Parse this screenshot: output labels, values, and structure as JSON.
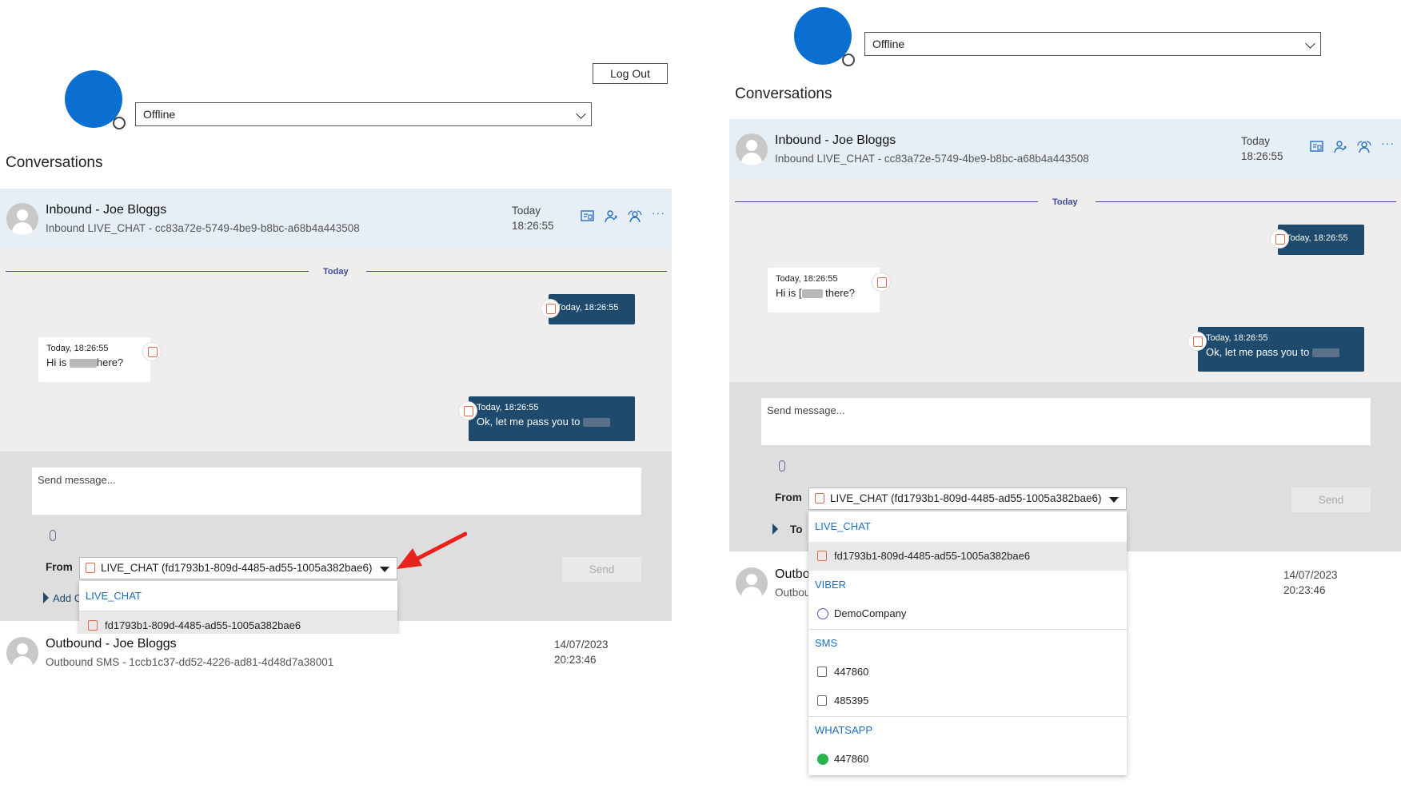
{
  "left": {
    "logout_label": "Log Out",
    "status": "Offline",
    "heading": "Conversations",
    "conversations": [
      {
        "title": "Inbound - Joe Bloggs",
        "subtitle": "Inbound LIVE_CHAT - cc83a72e-5749-4be9-b8bc-a68b4a443508",
        "date": "Today",
        "time": "18:26:55"
      },
      {
        "title": "Outbound - Joe Bloggs",
        "subtitle": "Outbound SMS - 1ccb1c37-dd52-4226-ad81-4d48d7a38001",
        "date": "14/07/2023",
        "time": "20:23:46"
      }
    ],
    "day_label": "Today",
    "messages": [
      {
        "direction": "out",
        "timestamp": "Today, 18:26:55",
        "text": ""
      },
      {
        "direction": "in",
        "timestamp": "Today, 18:26:55",
        "text_pre": "Hi is",
        "text_post": "here?"
      },
      {
        "direction": "out",
        "timestamp": "Today, 18:26:55",
        "text_pre": "Ok, let me pass you to",
        "text_post": ""
      }
    ],
    "compose_placeholder": "Send message...",
    "from_label": "From",
    "from_value": "LIVE_CHAT (fd1793b1-809d-4485-ad55-1005a382bae6)",
    "send_label": "Send",
    "add_label": "Add C",
    "dropdown": {
      "group": "LIVE_CHAT",
      "item": "fd1793b1-809d-4485-ad55-1005a382bae6"
    },
    "annotation_arrow_color": "#e8231b"
  },
  "right": {
    "status": "Offline",
    "heading": "Conversations",
    "conversations": [
      {
        "title": "Inbound - Joe Bloggs",
        "subtitle": "Inbound LIVE_CHAT - cc83a72e-5749-4be9-b8bc-a68b4a443508",
        "date": "Today",
        "time": "18:26:55"
      },
      {
        "title": "Outbo",
        "subtitle": "Outbou",
        "date": "14/07/2023",
        "time": "20:23:46"
      }
    ],
    "day_label": "Today",
    "messages": [
      {
        "direction": "out",
        "timestamp": "Today, 18:26:55",
        "text": ""
      },
      {
        "direction": "in",
        "timestamp": "Today, 18:26:55",
        "text_pre": "Hi is [",
        "text_post": "there?"
      },
      {
        "direction": "out",
        "timestamp": "Today, 18:26:55",
        "text_pre": "Ok, let me pass you to",
        "text_post": ""
      }
    ],
    "compose_placeholder": "Send message...",
    "from_label": "From",
    "to_label": "To",
    "from_value": "LIVE_CHAT (fd1793b1-809d-4485-ad55-1005a382bae6)",
    "send_label": "Send",
    "dropdown": {
      "groups": [
        {
          "name": "LIVE_CHAT",
          "items": [
            "fd1793b1-809d-4485-ad55-1005a382bae6"
          ]
        },
        {
          "name": "VIBER",
          "items": [
            "DemoCompany"
          ]
        },
        {
          "name": "SMS",
          "items": [
            "447860",
            "485395"
          ]
        },
        {
          "name": "WHATSAPP",
          "items": [
            "447860"
          ]
        }
      ]
    }
  },
  "colors": {
    "accent": "#0a6fd1",
    "selected_row": "#e6eff6",
    "chat_bg": "#f0eeed",
    "outgoing_bubble": "#1e4a6d",
    "divider": "#3b4b9a"
  }
}
